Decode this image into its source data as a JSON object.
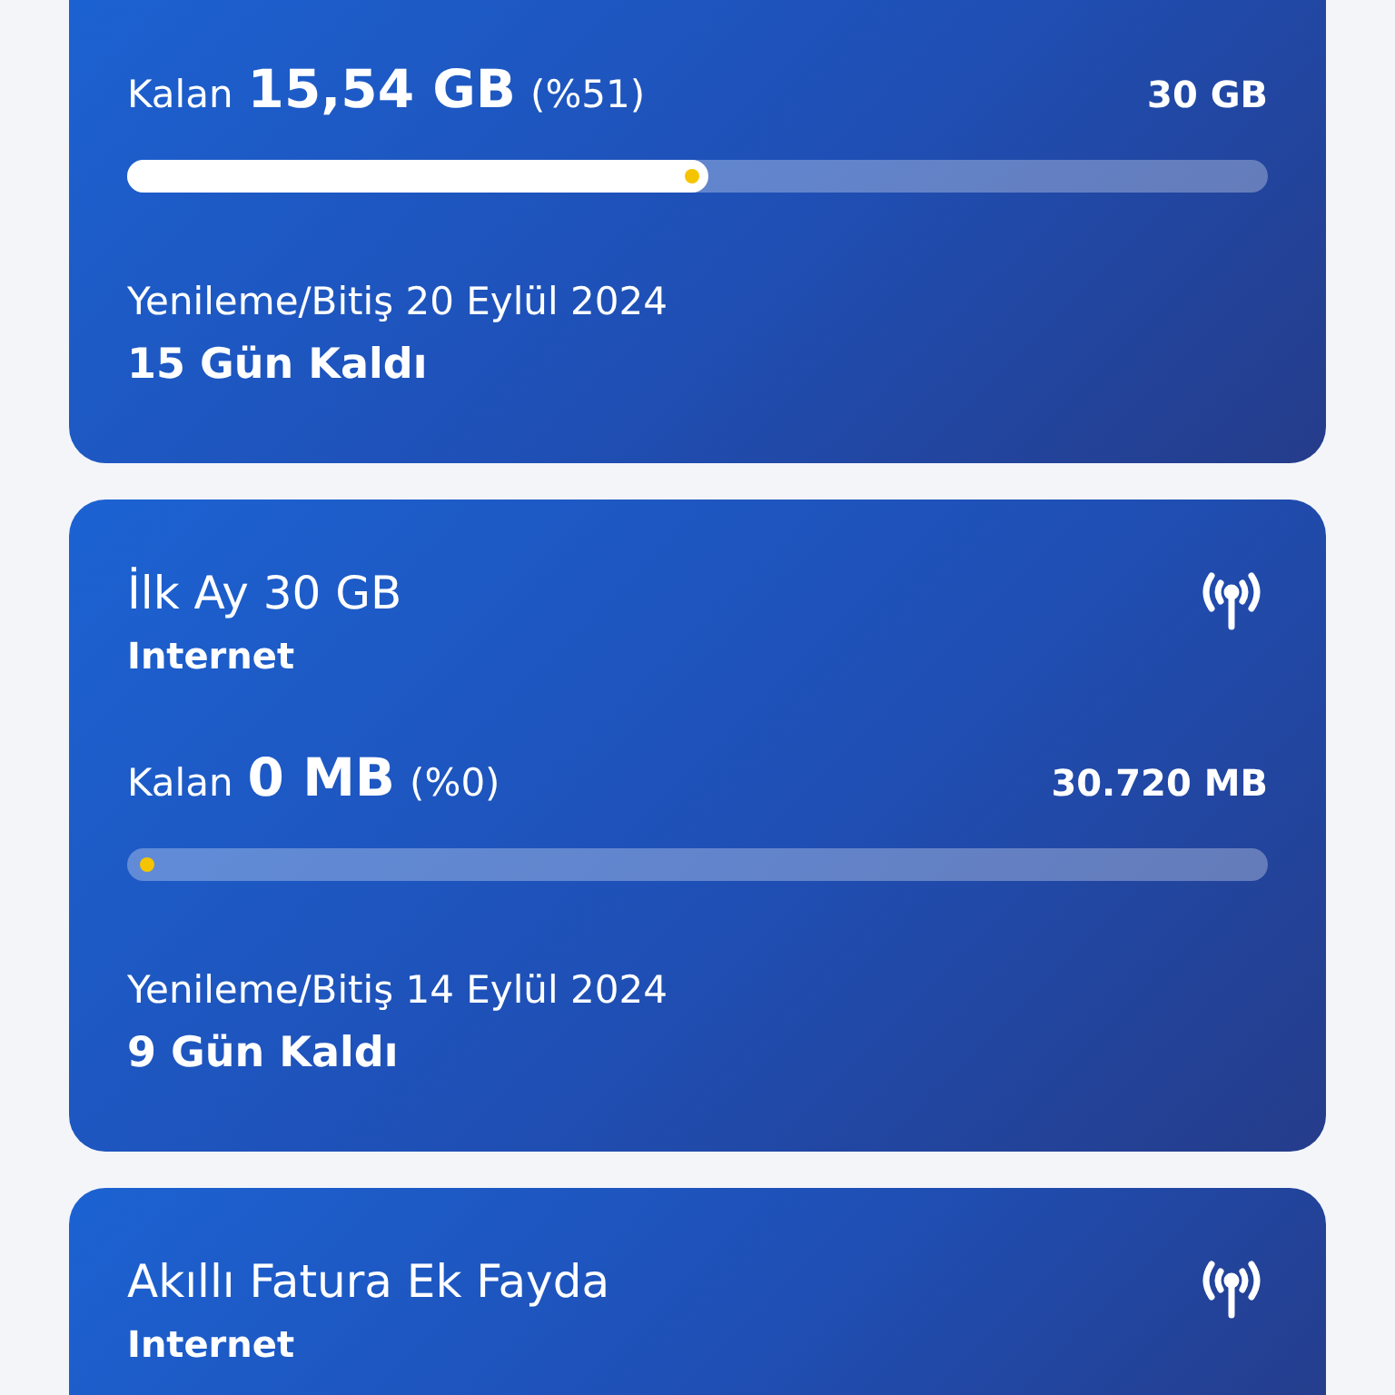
{
  "cards": [
    {
      "remaining_label": "Kalan",
      "remaining": "15,54 GB",
      "percent": "(%51)",
      "total": "30 GB",
      "level": 0.51,
      "renewal": "Yenileme/Bitiş 20 Eylül 2024",
      "days_left": "15 Gün Kaldı"
    },
    {
      "title": "İlk Ay 30 GB",
      "type": "Internet",
      "remaining_label": "Kalan",
      "remaining": "0 MB",
      "percent": "(%0)",
      "total": "30.720 MB",
      "level": 0,
      "renewal": "Yenileme/Bitiş 14 Eylül 2024",
      "days_left": "9 Gün Kaldı"
    },
    {
      "title": "Akıllı Fatura Ek Fayda",
      "type": "Internet"
    }
  ]
}
